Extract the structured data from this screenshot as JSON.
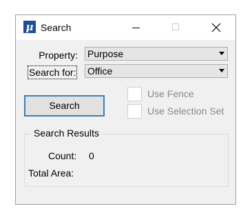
{
  "window": {
    "title": "Search",
    "app_icon_glyph": "µ",
    "icon": "microstation-icon"
  },
  "form": {
    "property_label": "Property:",
    "property_value": "Purpose",
    "search_for_label": "Search for:",
    "search_for_value": "Office",
    "search_button_label": "Search",
    "use_fence_label": "Use Fence",
    "use_selection_set_label": "Use Selection Set",
    "use_fence_checked": false,
    "use_selection_set_checked": false
  },
  "results": {
    "group_title": "Search Results",
    "count_label": "Count:",
    "count_value": "0",
    "total_area_label": "Total Area:",
    "total_area_value": ""
  },
  "colors": {
    "accent": "#3c7fb1",
    "app_icon": "#1a4fa0",
    "disabled_text": "#8a8a8a"
  }
}
